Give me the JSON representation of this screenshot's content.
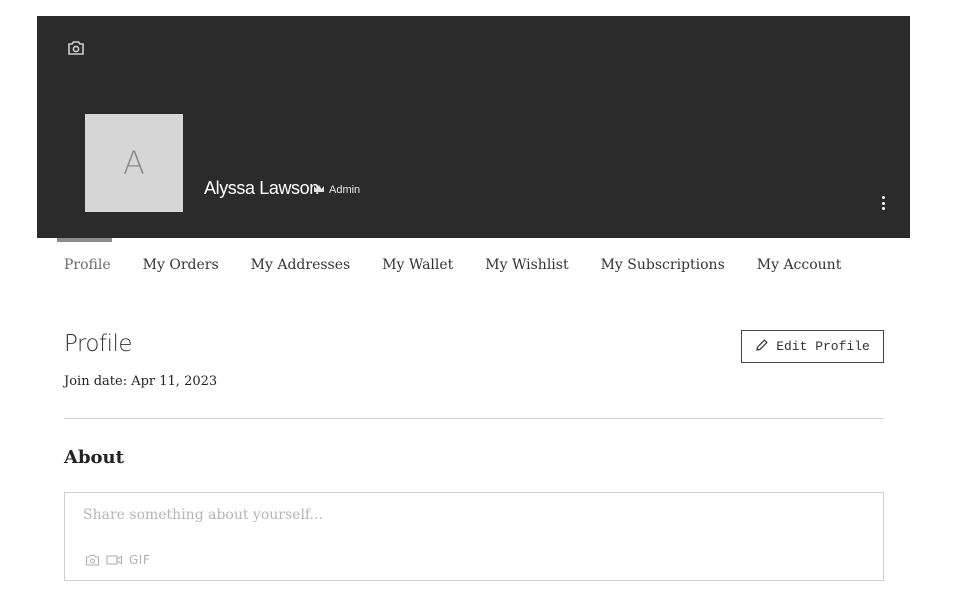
{
  "header": {
    "user_name": "Alyssa Lawson",
    "role": "Admin",
    "avatar_initial": "A",
    "cover_color": "#2b2b2b"
  },
  "tabs": [
    {
      "label": "Profile",
      "active": true
    },
    {
      "label": "My Orders"
    },
    {
      "label": "My Addresses"
    },
    {
      "label": "My Wallet"
    },
    {
      "label": "My Wishlist"
    },
    {
      "label": "My Subscriptions"
    },
    {
      "label": "My Account"
    }
  ],
  "profile": {
    "title": "Profile",
    "edit_label": "Edit Profile",
    "join_date": "Join date: Apr 11, 2023"
  },
  "about": {
    "title": "About",
    "placeholder": "Share something about yourself...",
    "gif_label": "GIF"
  },
  "icons": [
    "camera-icon",
    "crown-icon",
    "more-vertical-icon",
    "pencil-icon",
    "photo-icon",
    "video-icon"
  ]
}
